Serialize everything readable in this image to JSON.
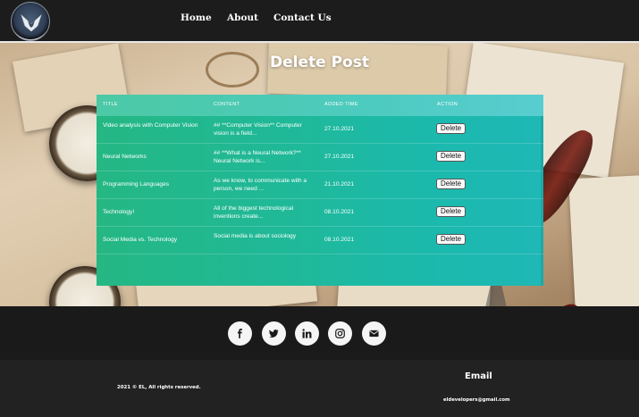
{
  "nav": {
    "logo_icon": "shield-hawk-logo",
    "links": [
      "Home",
      "About",
      "Contact Us"
    ]
  },
  "hero": {
    "title": "Delete Post"
  },
  "table": {
    "headers": [
      "Title",
      "Content",
      "Added Time",
      "Action"
    ],
    "rows": [
      {
        "title": "Video analysis with Computer Vision",
        "content": "## **Computer Vision** Computer vision is a field...",
        "time": "27.10.2021",
        "action": "Delete"
      },
      {
        "title": "Neural Networks",
        "content": "## **What is a Neural Network?** Neural Network is...",
        "time": "27.10.2021",
        "action": "Delete"
      },
      {
        "title": "Programming Languages",
        "content": "As we know, to communicate with a person, we need ...",
        "time": "21.10.2021",
        "action": "Delete"
      },
      {
        "title": "Technology!",
        "content": "All of the biggest technological inventions create...",
        "time": "08.10.2021",
        "action": "Delete"
      },
      {
        "title": "Social Media vs. Technology",
        "content": "Social media is about sociology",
        "time": "08.10.2021",
        "action": "Delete"
      }
    ]
  },
  "social": {
    "icons": [
      "facebook-icon",
      "twitter-icon",
      "linkedin-icon",
      "instagram-icon",
      "envelope-icon"
    ]
  },
  "footer": {
    "copyright": "2021 © EL, All rights reserved.",
    "email_title": "Email",
    "email": "eldevelopers@gmail.com"
  },
  "colors": {
    "navbar": "#1c1c1c",
    "table_start": "#25b783",
    "table_end": "#1fb8b6",
    "footer": "#222222"
  }
}
